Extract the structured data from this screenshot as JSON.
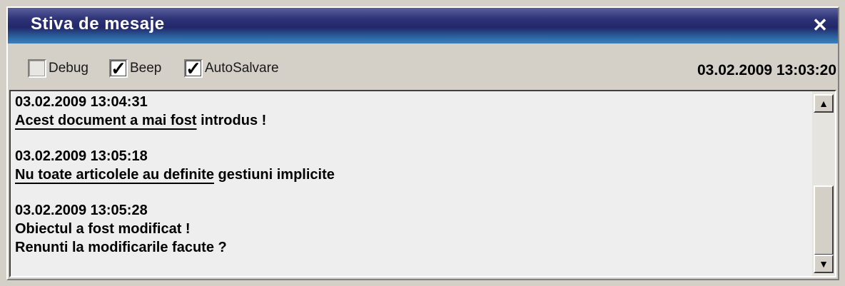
{
  "window": {
    "title": "Stiva de mesaje",
    "close_symbol": "✕"
  },
  "toolbar": {
    "checkboxes": [
      {
        "label": "Debug",
        "checked": false
      },
      {
        "label": "Beep",
        "checked": true
      },
      {
        "label": "AutoSalvare",
        "checked": true
      }
    ],
    "datetime": "03.02.2009 13:03:20"
  },
  "messages": [
    {
      "timestamp": "03.02.2009 13:04:31",
      "lines": [
        " Acest document a mai fost introdus !"
      ]
    },
    {
      "timestamp": "03.02.2009 13:05:18",
      "lines": [
        "Nu toate articolele au definite gestiuni implicite"
      ]
    },
    {
      "timestamp": "03.02.2009 13:05:28",
      "lines": [
        "Obiectul a fost modificat !",
        "Renunti la modificarile facute ?"
      ]
    }
  ],
  "scrollbar": {
    "up_icon": "▲",
    "down_icon": "▼"
  }
}
